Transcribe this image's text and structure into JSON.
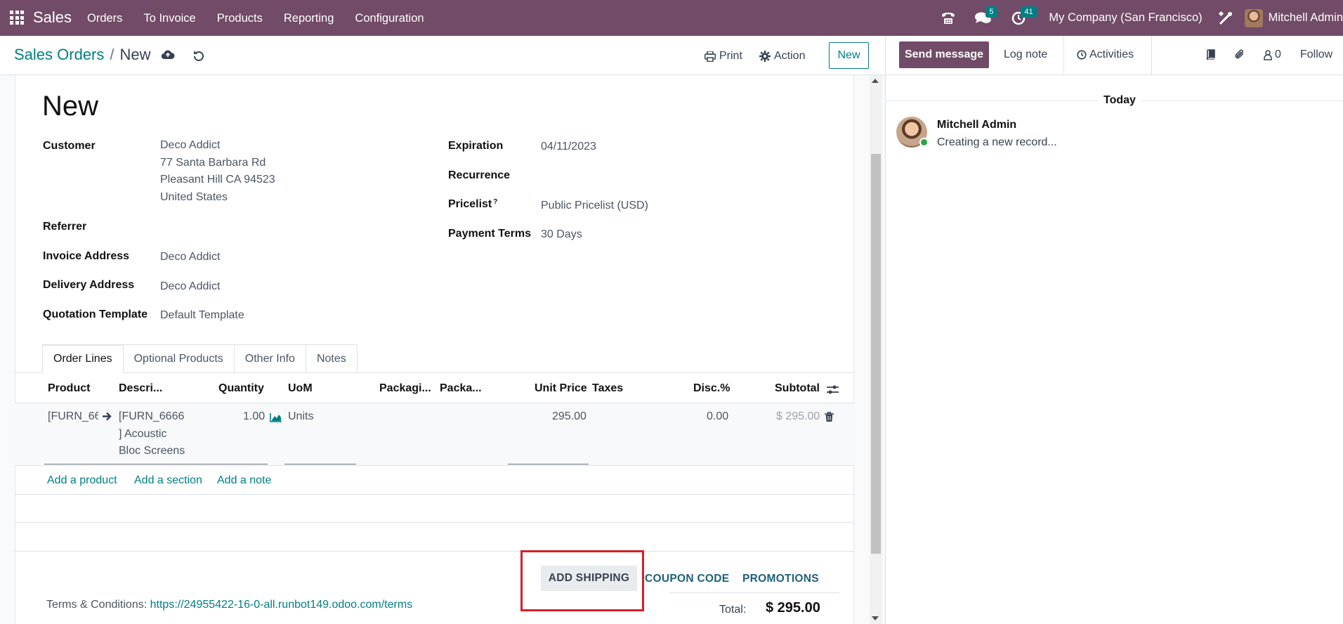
{
  "navbar": {
    "brand": "Sales",
    "menu": [
      "Orders",
      "To Invoice",
      "Products",
      "Reporting",
      "Configuration"
    ],
    "messages_count": "5",
    "activities_count": "41",
    "company": "My Company (San Francisco)",
    "user": "Mitchell Admin",
    "color": "#714B67"
  },
  "control": {
    "breadcrumb_parent": "Sales Orders",
    "breadcrumb_sep": "/",
    "breadcrumb_current": "New",
    "print": "Print",
    "action": "Action",
    "new": "New"
  },
  "chatter": {
    "send_message": "Send message",
    "log_note": "Log note",
    "activities": "Activities",
    "followers_count": "0",
    "follow": "Follow",
    "today": "Today",
    "author": "Mitchell Admin",
    "message": "Creating a new record..."
  },
  "form": {
    "title": "New",
    "customer_label": "Customer",
    "customer_lines": [
      "Deco Addict",
      "77 Santa Barbara Rd",
      "Pleasant Hill CA 94523",
      "United States"
    ],
    "referrer_label": "Referrer",
    "invoice_address_label": "Invoice Address",
    "invoice_address": "Deco Addict",
    "delivery_address_label": "Delivery Address",
    "delivery_address": "Deco Addict",
    "quotation_template_label": "Quotation Template",
    "quotation_template": "Default Template",
    "expiration_label": "Expiration",
    "expiration": "04/11/2023",
    "recurrence_label": "Recurrence",
    "pricelist_label": "Pricelist",
    "pricelist_help": "?",
    "pricelist": "Public Pricelist (USD)",
    "payment_terms_label": "Payment Terms",
    "payment_terms": "30 Days"
  },
  "tabs": [
    "Order Lines",
    "Optional Products",
    "Other Info",
    "Notes"
  ],
  "table": {
    "headers": [
      "Product",
      "Descri...",
      "Quantity",
      "UoM",
      "Packagi...",
      "Packa...",
      "Unit Price",
      "Taxes",
      "Disc.%",
      "Subtotal"
    ],
    "rows": [
      {
        "product": "[FURN_66",
        "description_lines": [
          "[FURN_6666",
          "] Acoustic",
          "Bloc Screens"
        ],
        "quantity": "1.00",
        "uom": "Units",
        "unit_price": "295.00",
        "discount": "0.00",
        "subtotal": "$ 295.00"
      }
    ],
    "add_product": "Add a product",
    "add_section": "Add a section",
    "add_note": "Add a note"
  },
  "footer": {
    "add_shipping": "ADD SHIPPING",
    "coupon_code": "COUPON CODE",
    "promotions": "PROMOTIONS",
    "terms_label": "Terms & Conditions:",
    "terms_url": "https://24955422-16-0-all.runbot149.odoo.com/terms",
    "total_label": "Total:",
    "total_value": "$ 295.00"
  }
}
